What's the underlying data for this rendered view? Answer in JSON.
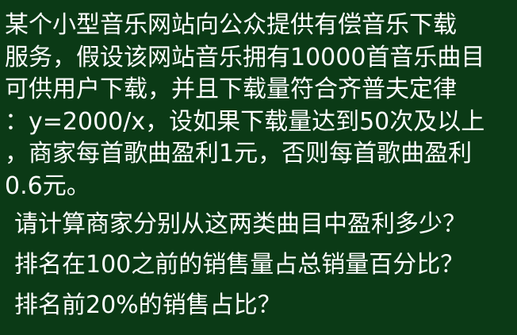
{
  "paragraph": {
    "lines": [
      "某个小型音乐网站向公众提供有偿音乐下载",
      "服务，假设该网站音乐拥有10000首音乐曲目",
      "可供用户下载，并且下载量符合齐普夫定律",
      "：y=2000/x，设如果下载量达到50次及以上",
      "，商家每首歌曲盈利1元，否则每首歌曲盈利",
      "0.6元。"
    ]
  },
  "questions": [
    "请计算商家分别从这两类曲目中盈利多少？",
    "排名在100之前的销售量占总销量百分比？",
    "排名前20%的销售占比？"
  ],
  "colors": {
    "background": "#0b3a16",
    "text": "#ffffff"
  }
}
